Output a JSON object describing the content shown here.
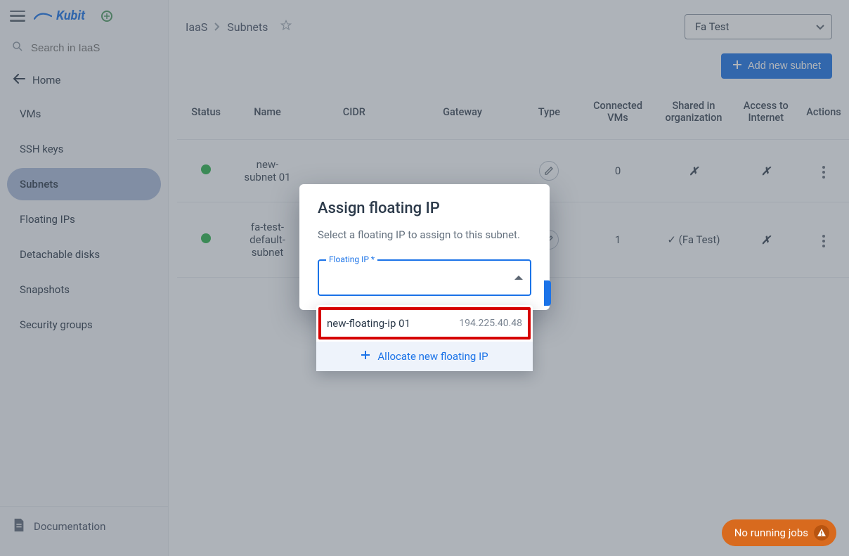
{
  "app": {
    "brand": "Kubit"
  },
  "search": {
    "placeholder": "Search in IaaS"
  },
  "sidebar": {
    "home": "Home",
    "items": [
      {
        "label": "VMs"
      },
      {
        "label": "SSH keys"
      },
      {
        "label": "Subnets"
      },
      {
        "label": "Floating IPs"
      },
      {
        "label": "Detachable disks"
      },
      {
        "label": "Snapshots"
      },
      {
        "label": "Security groups"
      }
    ],
    "footer": "Documentation"
  },
  "breadcrumb": {
    "root": "IaaS",
    "page": "Subnets"
  },
  "org": {
    "selected": "Fa Test"
  },
  "toolbar": {
    "add_label": "Add new subnet"
  },
  "table": {
    "headers": {
      "status": "Status",
      "name": "Name",
      "cidr": "CIDR",
      "gateway": "Gateway",
      "type": "Type",
      "connected": "Connected VMs",
      "shared": "Shared in organization",
      "access": "Access to Internet",
      "actions": "Actions"
    },
    "rows": [
      {
        "name": "new-subnet 01",
        "connected": "0",
        "shared": "✗",
        "access": "✗"
      },
      {
        "name": "fa-test-default-subnet",
        "connected": "1",
        "shared": "✓ (Fa Test)",
        "access": "✗"
      }
    ]
  },
  "dialog": {
    "title": "Assign floating IP",
    "desc": "Select a floating IP to assign to this subnet.",
    "field_label": "Floating IP *"
  },
  "dropdown": {
    "option": {
      "name": "new-floating-ip 01",
      "ip": "194.225.40.48"
    },
    "allocate": "Allocate new floating IP"
  },
  "jobs": {
    "label": "No running jobs"
  }
}
